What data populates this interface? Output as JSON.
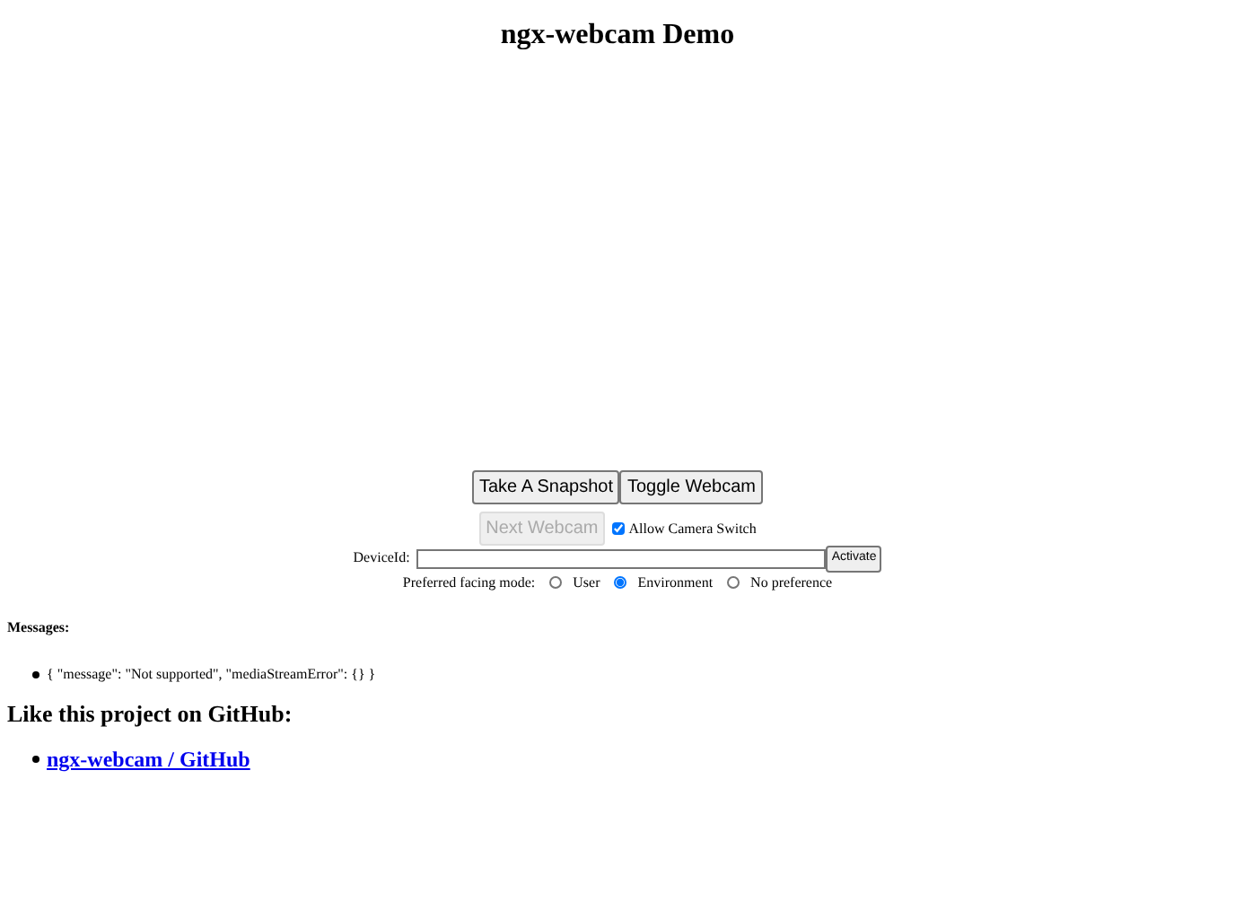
{
  "title": "ngx-webcam Demo",
  "buttons": [
    {
      "label": "Take A Snapshot",
      "disabled": false
    },
    {
      "label": "Toggle Webcam",
      "disabled": false
    }
  ],
  "next_button": {
    "label": "Next Webcam",
    "disabled": true
  },
  "allow_switch": {
    "label": "Allow Camera Switch",
    "checked": true
  },
  "device_id": {
    "label": "DeviceId:",
    "button": "Activate"
  },
  "facing_mode": {
    "label": "Preferred facing mode:",
    "options": [
      {
        "label": "User",
        "selected": false
      },
      {
        "label": "Environment",
        "selected": true
      },
      {
        "label": "No preference",
        "selected": false
      }
    ]
  },
  "messages": {
    "heading": "Messages:",
    "items": [
      "{ \"message\": \"Not supported\", \"mediaStreamError\": {} }"
    ]
  },
  "github": {
    "heading": "Like this project on GitHub:",
    "links": [
      "ngx-webcam / GitHub"
    ]
  }
}
